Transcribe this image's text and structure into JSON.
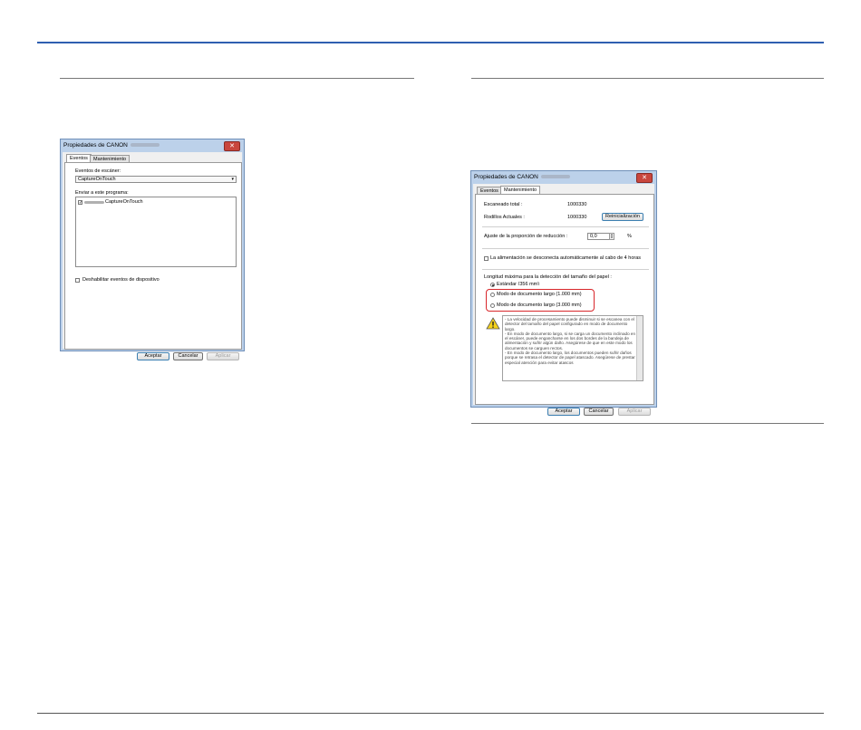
{
  "dialog1": {
    "title": "Propiedades de CANON",
    "close": "✕",
    "tabs": [
      "Eventos",
      "Mantenimiento"
    ],
    "events_label": "Eventos de escáner:",
    "events_value": "CaptureOnTouch",
    "send_label": "Enviar a este programa:",
    "program_item": "CaptureOnTouch",
    "disable_label": "Deshabilitar eventos de dispositivo",
    "buttons": {
      "ok": "Aceptar",
      "cancel": "Cancelar",
      "apply": "Aplicar"
    }
  },
  "dialog2": {
    "title": "Propiedades de CANON",
    "close": "✕",
    "tabs": [
      "Eventos",
      "Mantenimiento"
    ],
    "total_label": "Escaneado total :",
    "total_value": "1000330",
    "rollers_label": "Rodillos Actuales :",
    "rollers_value": "1000330",
    "reset_button": "Reinicialización",
    "reduction_label": "Ajuste de la proporción de reducción :",
    "reduction_value": "0,0",
    "reduction_unit": "%",
    "power_label": "La alimentación se desconecta automáticamente al cabo de 4 horas",
    "length_label": "Longitud máxima para la detección del tamaño del papel :",
    "radio_standard": "Estándar (356 mm)",
    "radio_long1": "Modo de documento largo (1.000 mm)",
    "radio_long3": "Modo de documento largo (3.000 mm)",
    "warning_text": "- La velocidad de procesamiento puede disminuir si se escanea con el detector del tamaño del papel configurado en modo de documento largo.\n- En modo de documento largo, si se carga un documento inclinado en el escáner, puede engancharse en los dos bordes de la bandeja de alimentación y sufrir algún daño. Asegúrese de que en este modo los documentos se carguen rectos.\n- En modo de documento largo, los documentos pueden sufrir daños porque se retrasa el detector de papel atascado. Asegúrese de prestar especial atención para evitar atascos",
    "buttons": {
      "ok": "Aceptar",
      "cancel": "Cancelar",
      "apply": "Aplicar"
    }
  },
  "colors": {
    "accent_rule": "#2f5fb0",
    "highlight": "#d8262b"
  },
  "icons": {
    "warning": "warning-icon",
    "close": "close-icon"
  }
}
